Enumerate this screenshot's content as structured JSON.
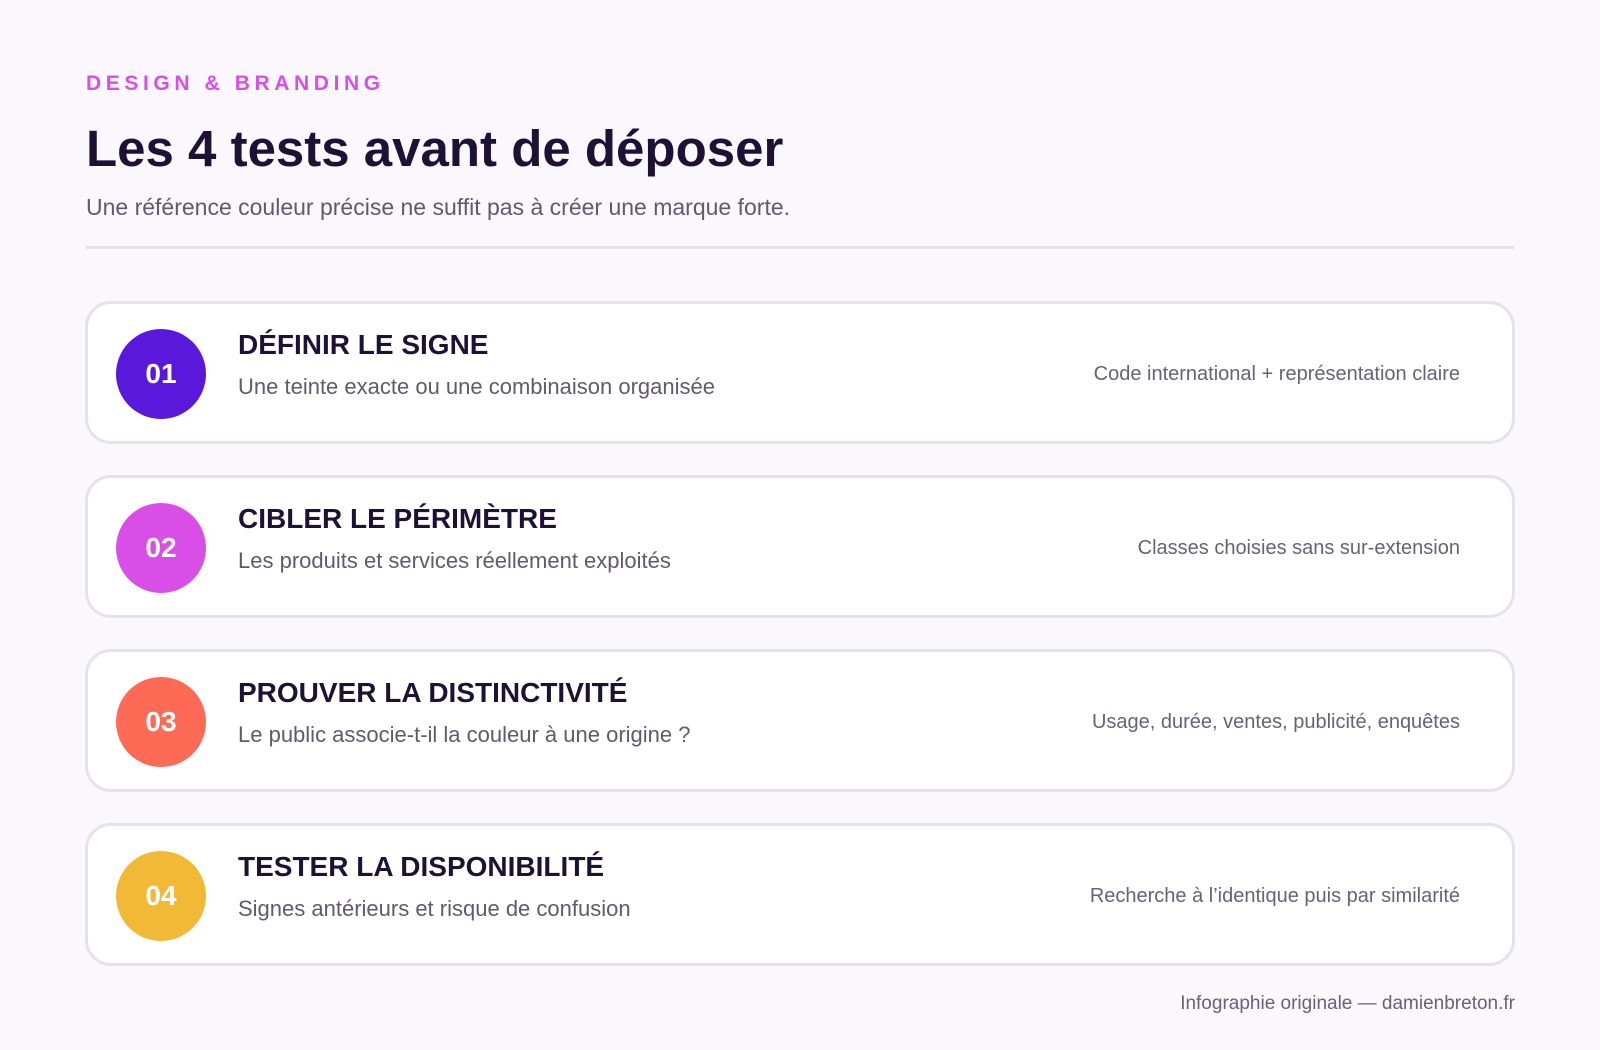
{
  "header": {
    "eyebrow": "DESIGN & BRANDING",
    "title": "Les 4 tests avant de déposer",
    "subtitle": "Une référence couleur précise ne suffit pas à créer une marque forte."
  },
  "steps": [
    {
      "number": "01",
      "title": "DÉFINIR LE SIGNE",
      "description": "Une teinte exacte ou une combinaison organisée",
      "note": "Code international + représentation claire",
      "color": "#5b18dd"
    },
    {
      "number": "02",
      "title": "CIBLER LE PÉRIMÈTRE",
      "description": "Les produits et services réellement exploités",
      "note": "Classes choisies sans sur-extension",
      "color": "#d94ee6"
    },
    {
      "number": "03",
      "title": "PROUVER LA DISTINCTIVITÉ",
      "description": "Le public associe-t-il la couleur à une origine ?",
      "note": "Usage, durée, ventes, publicité, enquêtes",
      "color": "#fd6a55"
    },
    {
      "number": "04",
      "title": "TESTER LA DISPONIBILITÉ",
      "description": "Signes antérieurs et risque de confusion",
      "note": "Recherche à l’identique puis par similarité",
      "color": "#f2b937"
    }
  ],
  "footer": {
    "credit": "Infographie originale — damienbreton.fr"
  },
  "colors": {
    "background": "#faf7fd",
    "accent": "#d94ee6",
    "heading": "#1c1236",
    "body_text": "#5f5a6e",
    "card_border": "#e6e2ec"
  }
}
